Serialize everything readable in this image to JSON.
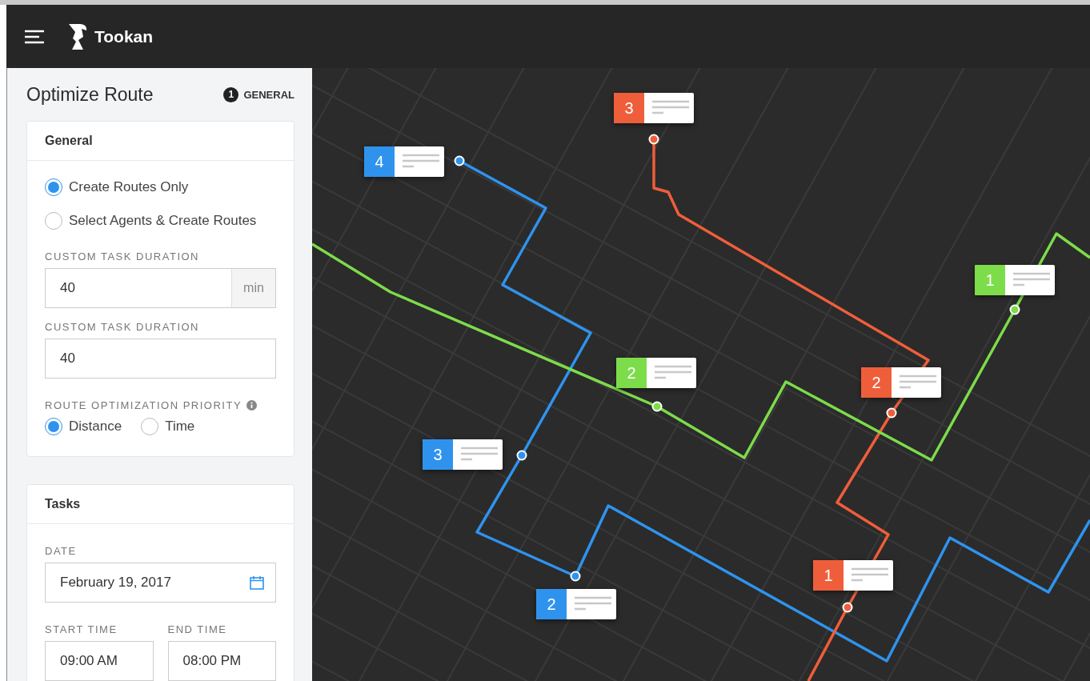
{
  "header": {
    "brand": "Tookan"
  },
  "sidebar": {
    "title": "Optimize Route",
    "step": {
      "number": "1",
      "label": "GENERAL"
    },
    "general": {
      "heading": "General",
      "modes": [
        {
          "label": "Create Routes Only",
          "selected": true
        },
        {
          "label": "Select Agents & Create Routes",
          "selected": false
        }
      ],
      "duration_with_unit": {
        "label": "CUSTOM TASK DURATION",
        "value": "40",
        "unit": "min"
      },
      "duration": {
        "label": "CUSTOM TASK DURATION",
        "value": "40"
      },
      "priority": {
        "label": "ROUTE OPTIMIZATION PRIORITY",
        "options": [
          {
            "label": "Distance",
            "selected": true
          },
          {
            "label": "Time",
            "selected": false
          }
        ]
      }
    },
    "tasks": {
      "heading": "Tasks",
      "date": {
        "label": "DATE",
        "value": "February 19, 2017"
      },
      "start_time": {
        "label": "START TIME",
        "value": "09:00 AM"
      },
      "end_time": {
        "label": "END TIME",
        "value": "08:00 PM"
      }
    }
  },
  "map": {
    "routes": [
      {
        "color": "#2f93ee",
        "markers": [
          {
            "number": "4"
          },
          {
            "number": "3"
          },
          {
            "number": "2"
          }
        ]
      },
      {
        "color": "#ef5e3a",
        "markers": [
          {
            "number": "3"
          },
          {
            "number": "2"
          },
          {
            "number": "1"
          }
        ]
      },
      {
        "color": "#7ddc4a",
        "markers": [
          {
            "number": "1"
          },
          {
            "number": "2"
          }
        ]
      }
    ]
  }
}
